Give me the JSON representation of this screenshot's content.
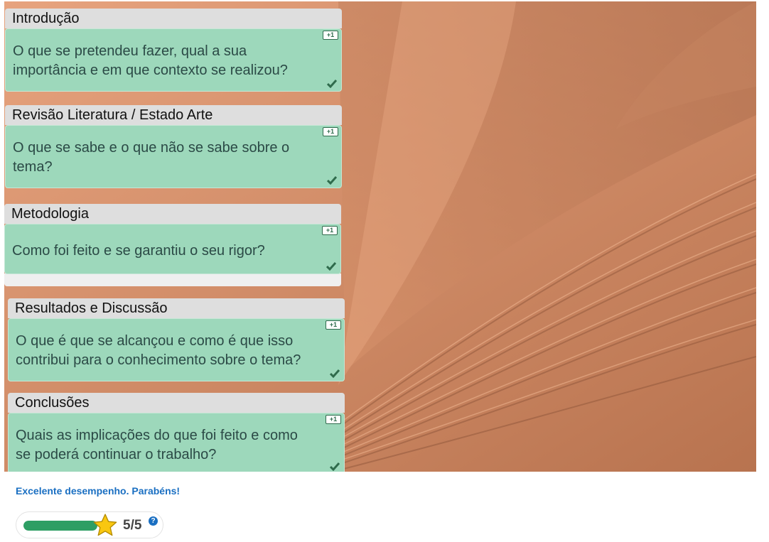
{
  "sections": [
    {
      "title": "Introdução",
      "text": "O que se pretendeu fazer, qual a sua importância e em que contexto se realizou?",
      "badge": "+1"
    },
    {
      "title": "Revisão Literatura / Estado Arte",
      "text": "O que se sabe e o que não se sabe sobre o tema?",
      "badge": "+1"
    },
    {
      "title": "Metodologia",
      "text": "Como foi  feito e se garantiu o seu rigor?",
      "badge": "+1"
    },
    {
      "title": "Resultados e Discussão",
      "text": "O que é que se alcançou e como é que isso contribui para o conhecimento sobre o tema?",
      "badge": "+1"
    },
    {
      "title": "Conclusões",
      "text": "Quais as implicações do que foi feito e como se poderá continuar o trabalho?",
      "badge": "+1"
    }
  ],
  "feedback": "Excelente desempenho. Parabéns!",
  "score": {
    "text": "5/5",
    "progress": 1.0,
    "help": "?"
  },
  "colors": {
    "card": "#9dd8bb",
    "header": "#dedede",
    "progress": "#2e9e64",
    "feedback": "#1a6fc2"
  },
  "icons": {
    "badge": "plus-one-icon",
    "check": "checkmark-icon",
    "star": "star-icon",
    "help": "help-icon"
  }
}
